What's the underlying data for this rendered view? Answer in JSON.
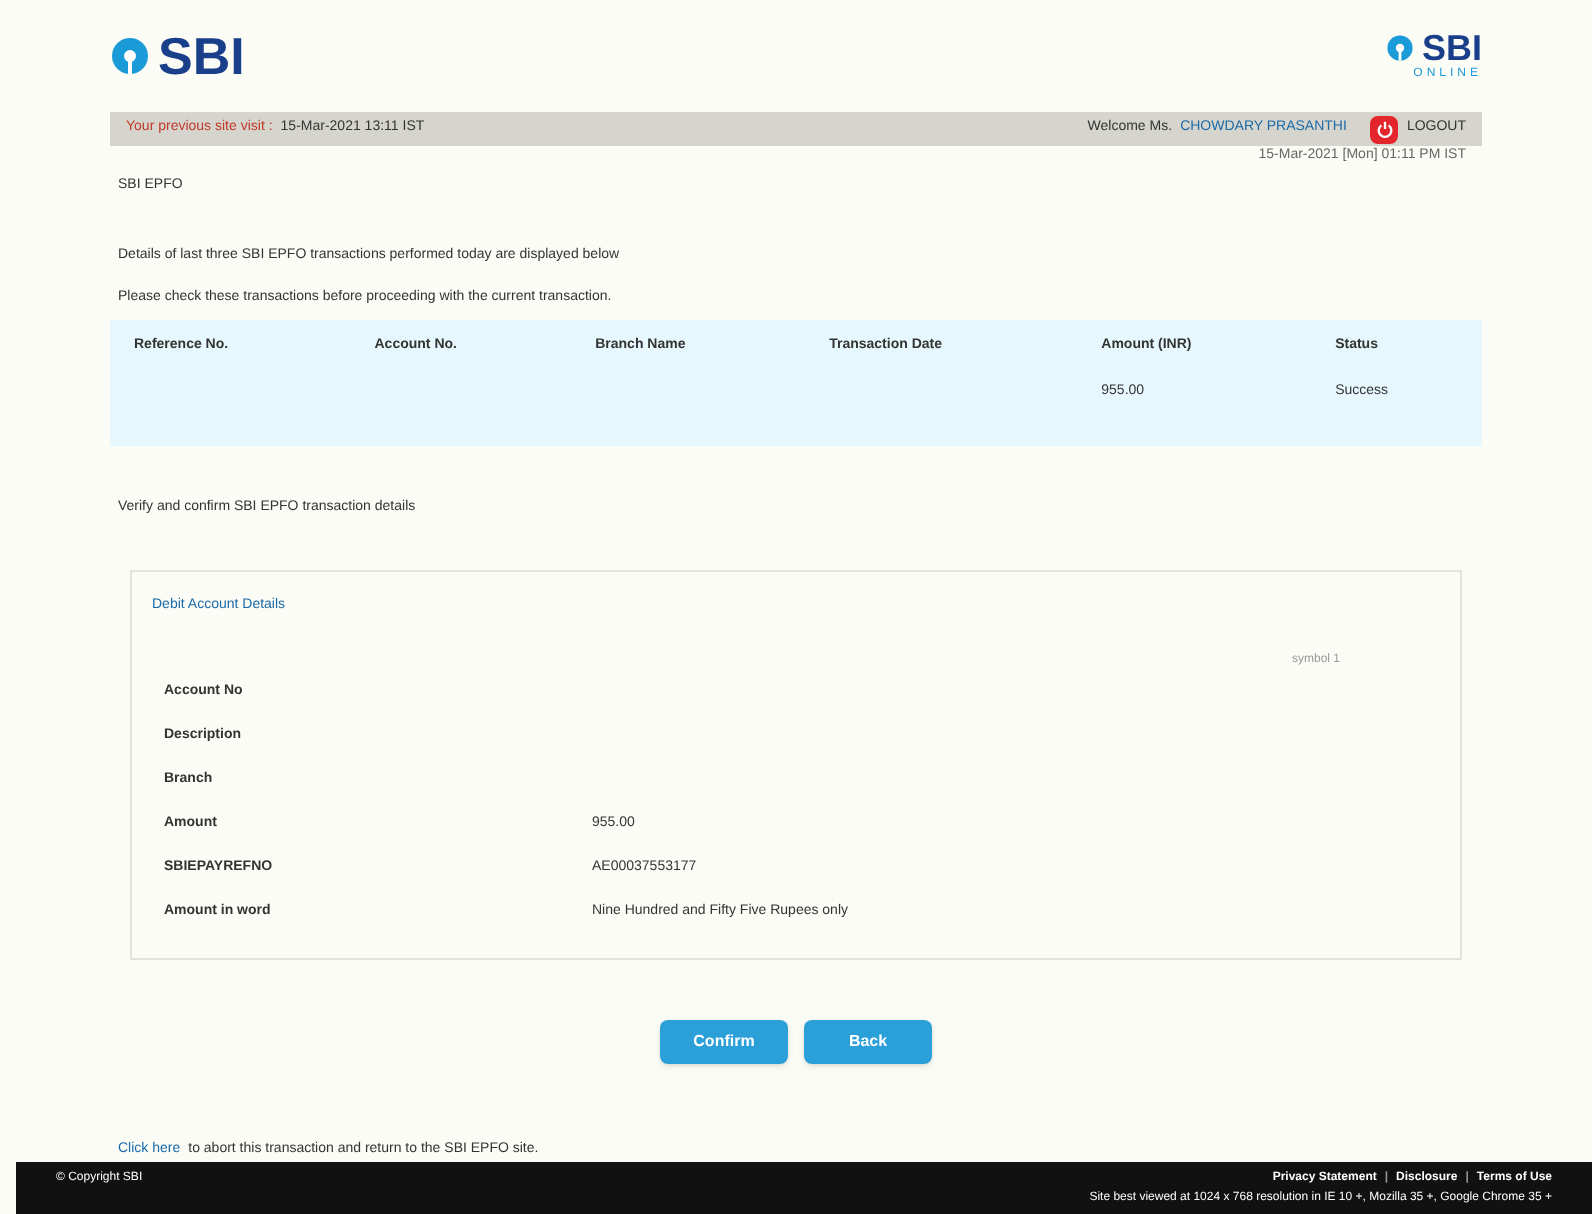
{
  "header": {
    "logo_left": "SBI",
    "logo_right": "SBI",
    "logo_right_sub": "ONLINE"
  },
  "info_bar": {
    "last_visit_label": "Your previous site visit :",
    "last_visit_value": "15-Mar-2021 13:11 IST",
    "welcome_label": "Welcome Ms.",
    "welcome_name": "CHOWDARY PRASANTHI",
    "logout": "LOGOUT"
  },
  "date_time": "15-Mar-2021 [Mon] 01:11 PM IST",
  "page_title": "SBI EPFO",
  "intro": "Details of last three SBI EPFO transactions performed today are displayed below",
  "check_note": "Please check these transactions before proceeding with the current transaction.",
  "table": {
    "columns": [
      "Reference No.",
      "Account No.",
      "Branch Name",
      "Transaction Date",
      "Amount (INR)",
      "Status"
    ],
    "rows": [
      [
        "",
        "",
        "",
        "",
        "955.00",
        "Success"
      ]
    ]
  },
  "verify_note": "Verify and confirm SBI EPFO transaction details",
  "details": {
    "title": "Debit Account Details",
    "side_note": "symbol 1",
    "rows": [
      {
        "label": "Account No",
        "value": ""
      },
      {
        "label": "Description",
        "value": ""
      },
      {
        "label": "Branch",
        "value": ""
      },
      {
        "label": "Amount",
        "value": "955.00"
      },
      {
        "label": "SBIEPAYREFNO",
        "value": "AE00037553177"
      },
      {
        "label": "Amount in word",
        "value": "Nine Hundred and Fifty Five Rupees only"
      }
    ]
  },
  "buttons": [
    "Confirm",
    "Back"
  ],
  "abort": {
    "link": "Click here",
    "text": "to abort this transaction and return to the SBI EPFO site."
  },
  "footer": {
    "copyright": "© Copyright SBI",
    "links": [
      "Privacy Statement",
      "Disclosure",
      "Terms of Use"
    ],
    "separator": "|",
    "note": "Site best viewed at 1024 x 768 resolution in IE 10 +, Mozilla 35 +, Google Chrome 35 +"
  }
}
